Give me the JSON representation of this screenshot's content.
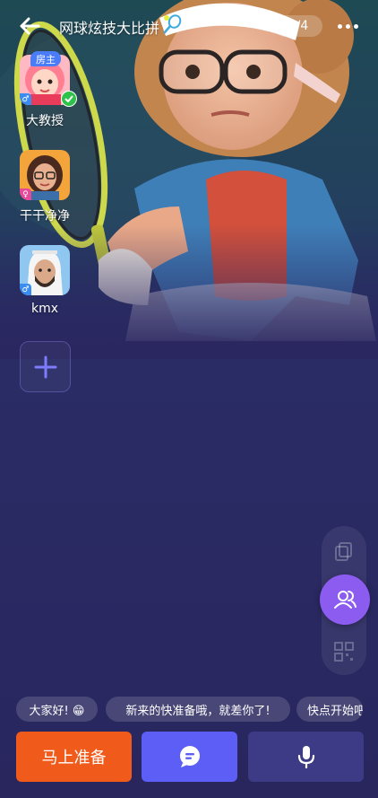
{
  "header": {
    "back_icon": "arrow-left-icon",
    "title": "网球炫技大比拼",
    "title_emoji_icon": "tennis-racket-emoji-icon",
    "player_count": "3/4",
    "more_icon": "ellipsis-icon"
  },
  "players": [
    {
      "name": "大教授",
      "badge": "房主",
      "gender_icon": "male-icon",
      "ready": true,
      "avatar_icon": "girl-pink-hair-avatar"
    },
    {
      "name": "干干净净",
      "gender_icon": "female-icon",
      "ready": false,
      "avatar_icon": "woman-glasses-avatar"
    },
    {
      "name": "kmx",
      "gender_icon": "male-icon",
      "ready": false,
      "avatar_icon": "man-headscarf-avatar"
    }
  ],
  "add_slot_icon": "plus-icon",
  "side_rail": {
    "top_icon": "copy-icon",
    "center_icon": "members-icon",
    "bottom_icon": "qr-code-icon"
  },
  "quick_messages": [
    "大家好! 😁",
    "新来的快准备哦，就差你了!",
    "快点开始吧"
  ],
  "actions": {
    "ready_label": "马上准备",
    "chat_icon": "chat-bubble-icon",
    "mic_icon": "microphone-icon"
  },
  "colors": {
    "background": "#2a2660",
    "ready_button": "#f05a1a",
    "chat_button": "#5c5ef5",
    "mic_button": "#3d3b86",
    "members_button": "#8c5cf0",
    "host_badge": "#4a7cf7",
    "male": "#3a8cf0",
    "female": "#e8489a",
    "ready_check": "#2ec24a"
  }
}
